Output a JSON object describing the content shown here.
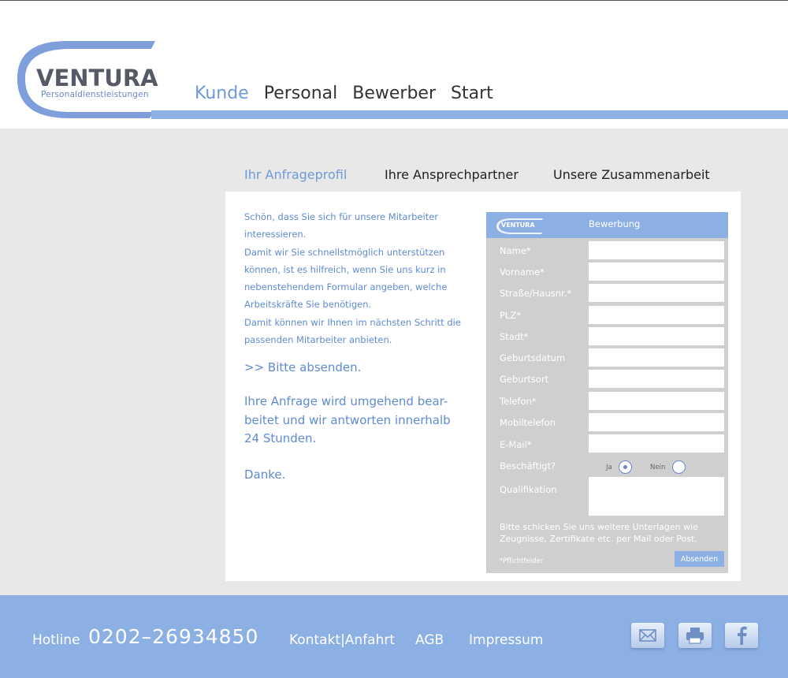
{
  "brand": {
    "name": "VENTURA",
    "tagline": "Personaldienstleistungen",
    "accent_color": "#8db0e4",
    "text_color": "#5f8bd1"
  },
  "nav": {
    "items": [
      {
        "label": "Kunde",
        "active": true
      },
      {
        "label": "Personal",
        "active": false
      },
      {
        "label": "Bewerber",
        "active": false
      },
      {
        "label": "Start",
        "active": false
      }
    ]
  },
  "tabs": [
    {
      "label": "Ihr Anfrageprofil",
      "active": true
    },
    {
      "label": "Ihre Ansprechpartner",
      "active": false
    },
    {
      "label": "Unsere Zusammenarbeit",
      "active": false
    }
  ],
  "intro": {
    "lines": [
      "Schön, dass Sie sich für unsere Mitarbeiter",
      "interessieren.",
      "Damit wir Sie schnellstmöglich unterstützen",
      "können, ist es hilfreich, wenn Sie uns kurz in",
      "nebenstehendem Formular angeben, welche",
      "Arbeitskräfte Sie benötigen.",
      "Damit können wir Ihnen im nächsten Schritt die",
      "passenden Mitarbeiter anbieten."
    ],
    "cta": ">> Bitte absenden.",
    "notice_lines": [
      "Ihre Anfrage wird umgehend bear-",
      "beitet und wir antworten innerhalb",
      "24 Stunden."
    ],
    "thanks": "Danke."
  },
  "form": {
    "logo_text": "VENTURA",
    "title": "Bewerbung",
    "fields": [
      {
        "label": "Name*",
        "value": ""
      },
      {
        "label": "Vorname*",
        "value": ""
      },
      {
        "label": "Straße/Hausnr.*",
        "value": ""
      },
      {
        "label": "PLZ*",
        "value": ""
      },
      {
        "label": "Stadt*",
        "value": ""
      },
      {
        "label": "Geburtsdatum",
        "value": ""
      },
      {
        "label": "Geburtsort",
        "value": ""
      },
      {
        "label": "Telefon*",
        "value": ""
      },
      {
        "label": "Mobiltelefon",
        "value": ""
      },
      {
        "label": "E-Mail*",
        "value": ""
      }
    ],
    "employed": {
      "label": "Beschäftigt?",
      "yes_label": "Ja",
      "no_label": "Nein",
      "selected": "Ja"
    },
    "qualification": {
      "label": "Qualifikation",
      "value": ""
    },
    "note": "Bitte schicken Sie uns weitere Unterlagen wie Zeugnisse, Zertifikate etc. per Mail oder Post.",
    "required_note": "*Pflichtfelder",
    "submit_label": "Absenden"
  },
  "footer": {
    "hotline_label": "Hotline",
    "hotline_number": "0202–26934850",
    "links": [
      "Kontakt|Anfahrt",
      "AGB",
      "Impressum"
    ],
    "icons": [
      "mail-icon",
      "print-icon",
      "facebook-icon"
    ]
  }
}
